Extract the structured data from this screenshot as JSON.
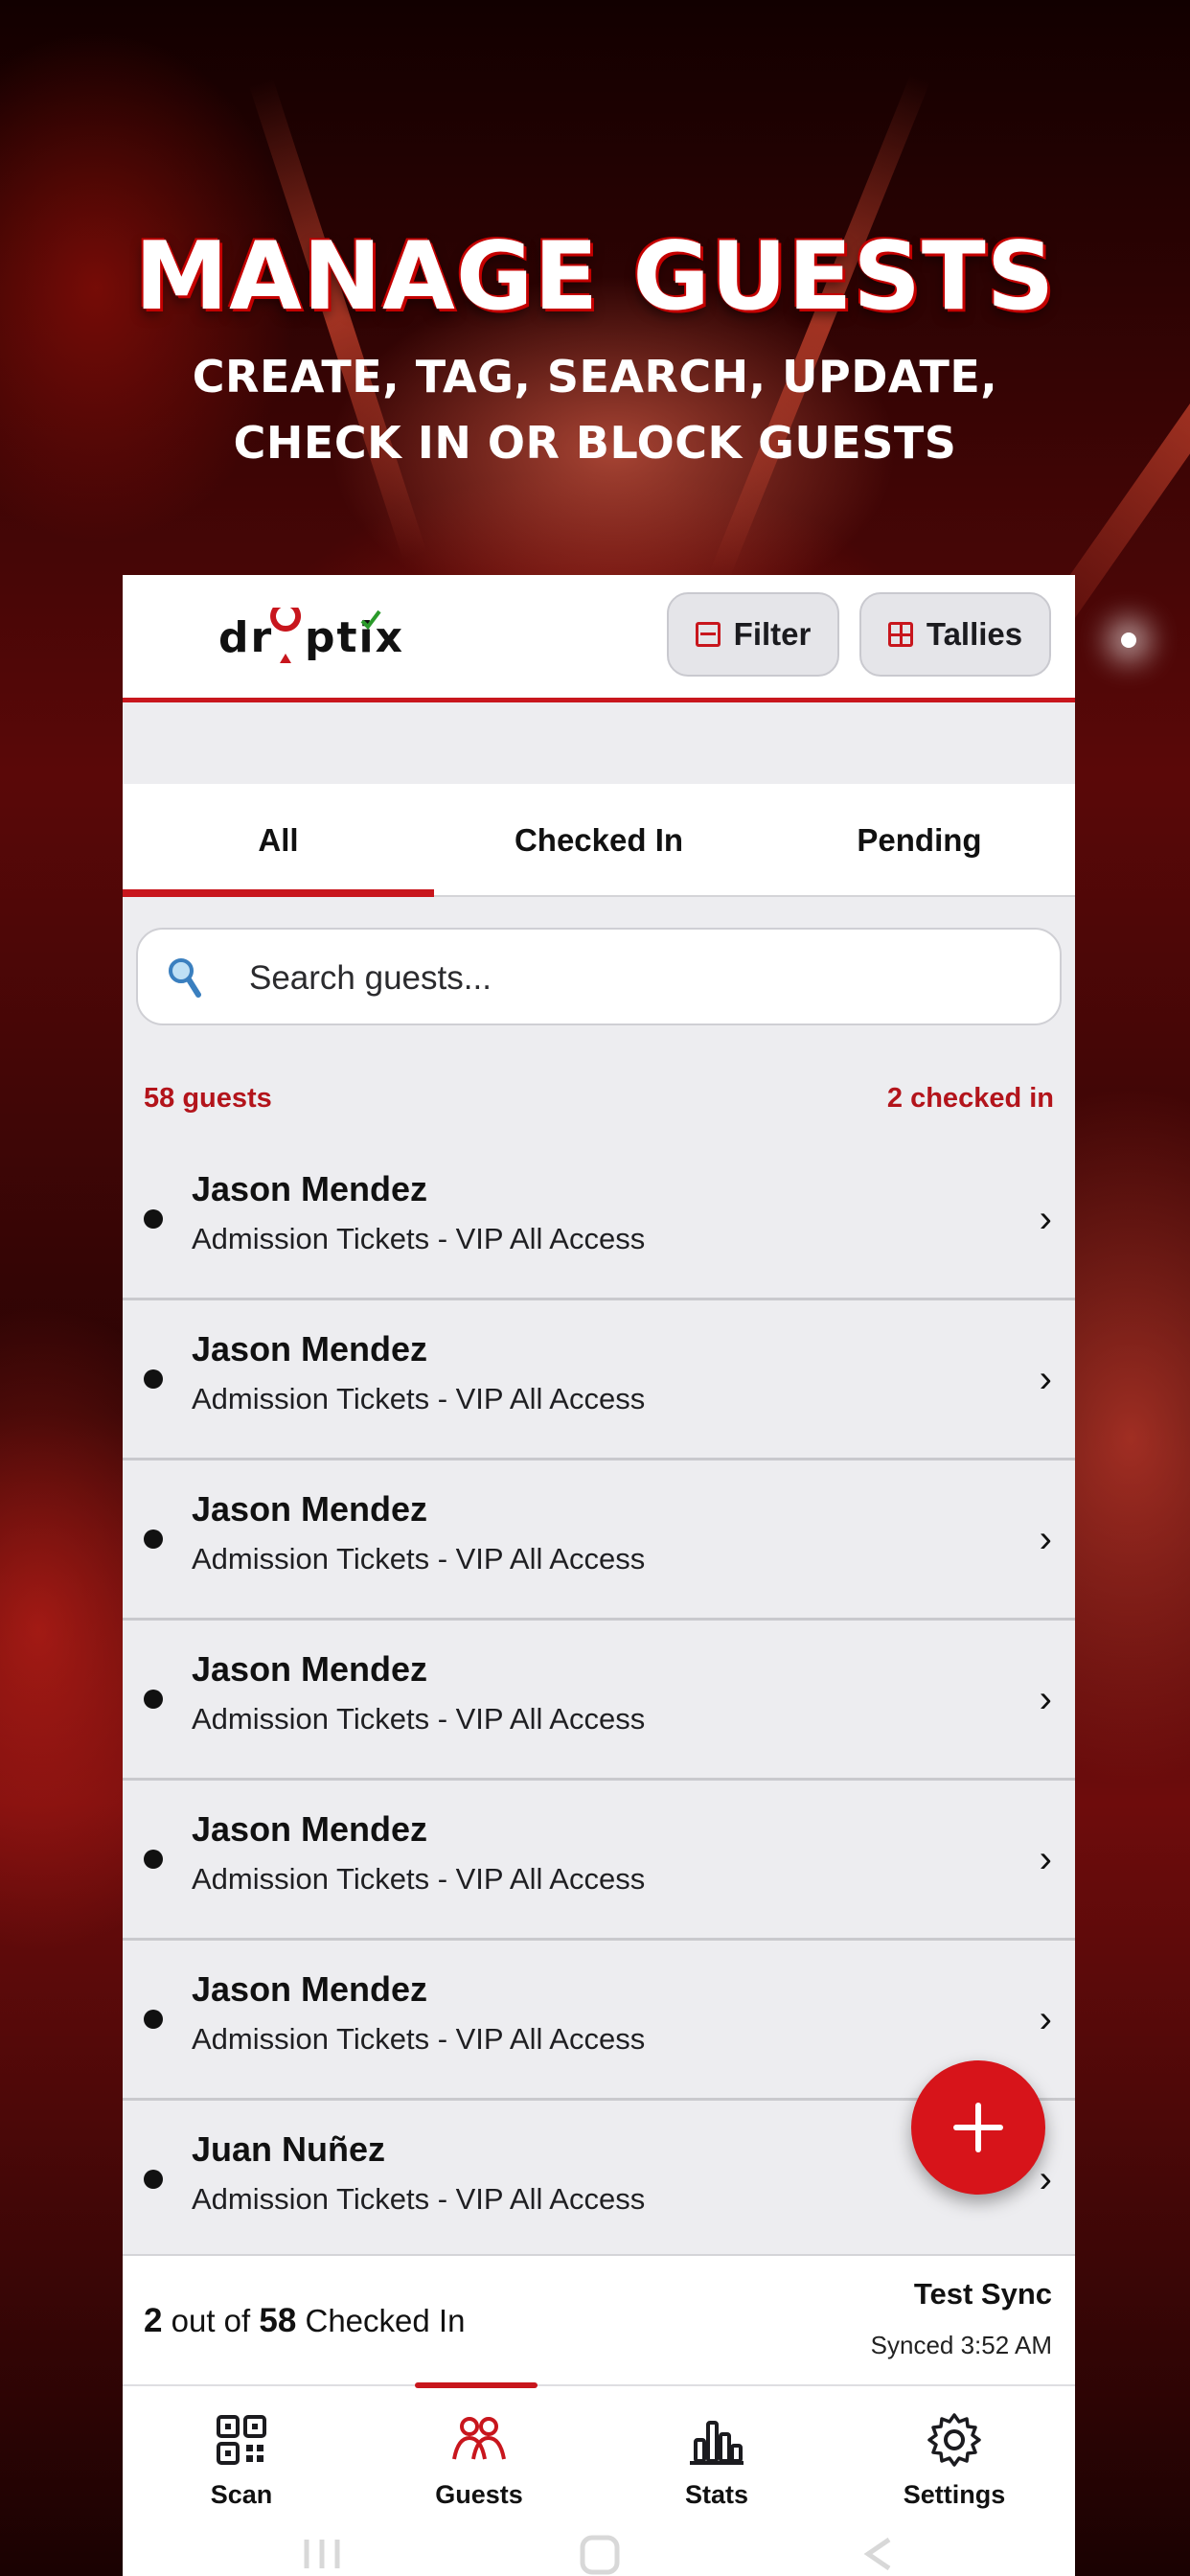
{
  "hero": {
    "title": "MANAGE GUESTS",
    "subtitle_line1": "CREATE, TAG, SEARCH, UPDATE,",
    "subtitle_line2": "CHECK IN OR BLOCK GUESTS"
  },
  "header": {
    "logo_text": "droptix",
    "filter_label": "Filter",
    "tallies_label": "Tallies"
  },
  "tabs": [
    {
      "label": "All",
      "active": true
    },
    {
      "label": "Checked In",
      "active": false
    },
    {
      "label": "Pending",
      "active": false
    }
  ],
  "search": {
    "placeholder": "Search guests..."
  },
  "summary": {
    "guest_count": "58 guests",
    "checked_in_count": "2 checked in"
  },
  "guests": [
    {
      "name": "Jason Mendez",
      "ticket": "Admission Tickets - VIP All Access"
    },
    {
      "name": "Jason Mendez",
      "ticket": "Admission Tickets - VIP All Access"
    },
    {
      "name": "Jason Mendez",
      "ticket": "Admission Tickets - VIP All Access"
    },
    {
      "name": "Jason Mendez",
      "ticket": "Admission Tickets - VIP All Access"
    },
    {
      "name": "Jason Mendez",
      "ticket": "Admission Tickets - VIP All Access"
    },
    {
      "name": "Jason Mendez",
      "ticket": "Admission Tickets - VIP All Access"
    },
    {
      "name": "Juan Nuñez",
      "ticket": "Admission Tickets - VIP All Access"
    }
  ],
  "status": {
    "checked_num": "2",
    "out_of": "out of",
    "total_num": "58",
    "checked_suffix": "Checked In",
    "sync_title": "Test Sync",
    "sync_time": "Synced 3:52 AM"
  },
  "nav": [
    {
      "label": "Scan",
      "icon": "qr-code-icon"
    },
    {
      "label": "Guests",
      "icon": "people-icon",
      "active": true
    },
    {
      "label": "Stats",
      "icon": "bar-chart-icon"
    },
    {
      "label": "Settings",
      "icon": "gear-icon"
    }
  ],
  "colors": {
    "accent": "#c8161d",
    "fab": "#d7141a"
  }
}
